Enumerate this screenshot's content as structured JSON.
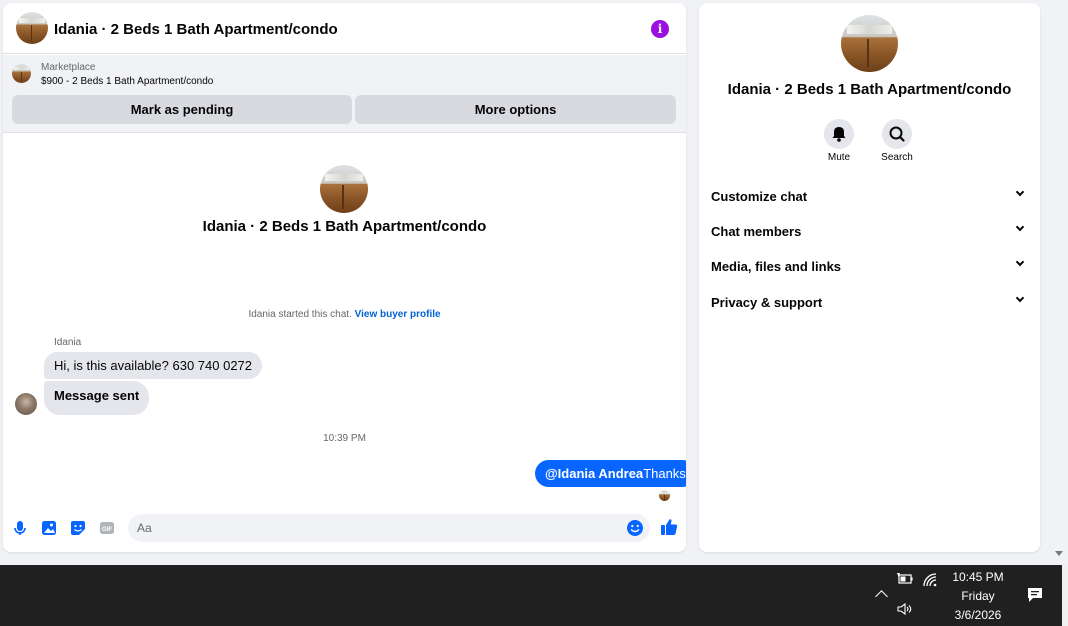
{
  "header": {
    "title": "Idania · 2 Beds 1 Bath Apartment/condo",
    "info_icon": "info-icon",
    "info_glyph": "i"
  },
  "listing": {
    "label": "Marketplace",
    "price_title": "$900 - 2 Beds 1 Bath Apartment/condo",
    "mark_pending_label": "Mark as pending",
    "more_options_label": "More options"
  },
  "conversation": {
    "title": "Idania · 2 Beds 1 Bath Apartment/condo",
    "started_text": "Idania started this chat. ",
    "view_profile_link": "View buyer profile",
    "sender_name": "Idania",
    "messages_in": [
      "Hi, is this available? 630 740 0272",
      "Message sent"
    ],
    "timestamp": "10:39 PM",
    "message_out": {
      "mention": "@Idania Andrea",
      "text": "Thanks"
    }
  },
  "composer": {
    "placeholder": "Aa",
    "icons": [
      "microphone-icon",
      "image-icon",
      "sticker-icon",
      "gif-icon",
      "emoji-icon",
      "thumbs-up-icon"
    ],
    "gif_label": "GIF"
  },
  "info_panel": {
    "title": "Idania · 2 Beds 1 Bath Apartment/condo",
    "actions": [
      {
        "label": "Mute",
        "icon": "bell-icon"
      },
      {
        "label": "Search",
        "icon": "search-icon"
      }
    ],
    "sections": [
      "Customize chat",
      "Chat members",
      "Media, files and links",
      "Privacy & support"
    ]
  },
  "taskbar": {
    "time": "10:45 PM",
    "day": "Friday",
    "date": "3/6/2026",
    "icons": [
      "chevron-up-icon",
      "battery-icon",
      "wifi-icon",
      "volume-icon",
      "notifications-icon"
    ]
  },
  "colors": {
    "accent_blue": "#0866ff",
    "info_purple": "#9b0fe0",
    "link_blue": "#0064d1",
    "taskbar": "#202020"
  }
}
